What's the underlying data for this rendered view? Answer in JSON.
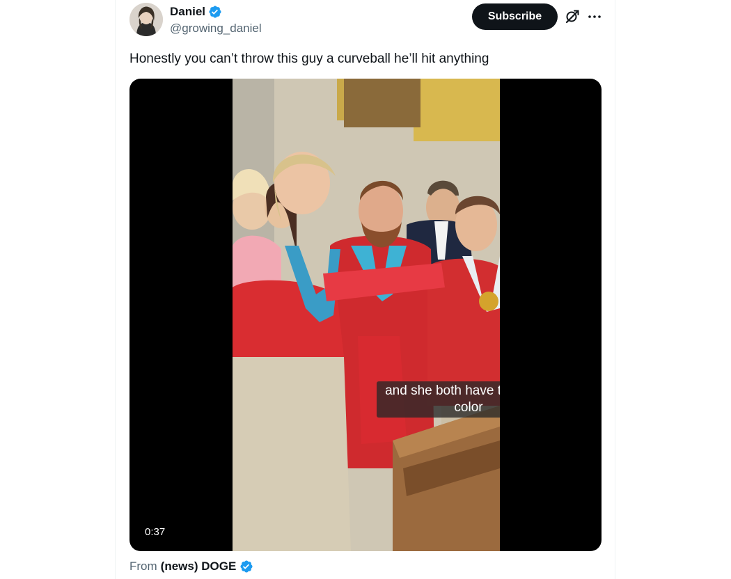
{
  "tweet": {
    "author": {
      "display_name": "Daniel",
      "handle": "@growing_daniel",
      "verified_icon": "verified-badge-icon",
      "avatar_icon": "avatar"
    },
    "actions": {
      "subscribe_label": "Subscribe",
      "grok_icon": "grok-icon",
      "more_icon": "more-icon"
    },
    "text": "Honestly you can’t throw this guy a curveball he’ll hit anything",
    "video": {
      "caption_line1": "and she both have the same",
      "caption_line2": "color",
      "duration": "0:37"
    },
    "source": {
      "prefix": "From",
      "name": "(news) DOGE",
      "verified_icon": "verified-badge-icon"
    }
  },
  "colors": {
    "accent_blue": "#1d9bf0",
    "text_primary": "#0f1419",
    "text_secondary": "#536471",
    "button_dark": "#0f1419"
  }
}
